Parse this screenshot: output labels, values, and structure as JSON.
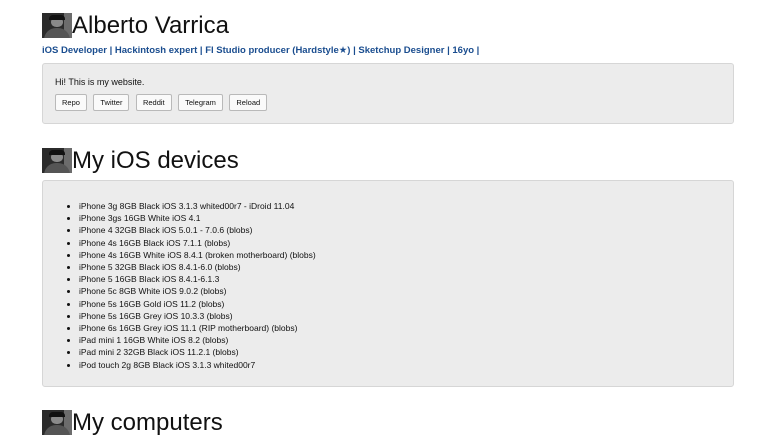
{
  "profile": {
    "name": "Alberto Varrica",
    "tagline": [
      "iOS Developer",
      "Hackintosh expert",
      "Fl Studio producer (Hardstyle★)",
      "Sketchup Designer",
      "16yo"
    ],
    "separator": " | "
  },
  "intro": {
    "text": "Hi! This is my website.",
    "buttons": [
      "Repo",
      "Twitter",
      "Reddit",
      "Telegram",
      "Reload"
    ]
  },
  "devices": {
    "title": "My iOS devices",
    "items": [
      "iPhone 3g 8GB Black iOS 3.1.3 whited00r7 - iDroid 11.04",
      "iPhone 3gs 16GB White iOS 4.1",
      "iPhone 4 32GB Black iOS 5.0.1 - 7.0.6 (blobs)",
      "iPhone 4s 16GB Black iOS 7.1.1 (blobs)",
      "iPhone 4s 16GB White iOS 8.4.1 (broken motherboard) (blobs)",
      "iPhone 5 32GB Black iOS 8.4.1-6.0 (blobs)",
      "iPhone 5 16GB Black iOS 8.4.1-6.1.3",
      "iPhone 5c 8GB White iOS 9.0.2 (blobs)",
      "iPhone 5s 16GB Gold iOS 11.2 (blobs)",
      "iPhone 5s 16GB Grey iOS 10.3.3 (blobs)",
      "iPhone 6s 16GB Grey iOS 11.1 (RIP motherboard) (blobs)",
      "iPad mini 1 16GB White iOS 8.2 (blobs)",
      "iPad mini 2 32GB Black iOS 11.2.1 (blobs)",
      "iPod touch 2g 8GB Black iOS 3.1.3 whited00r7"
    ]
  },
  "computers": {
    "title": "My computers"
  },
  "colors": {
    "panel_bg": "#ececec",
    "link": "#1a4d8f"
  }
}
